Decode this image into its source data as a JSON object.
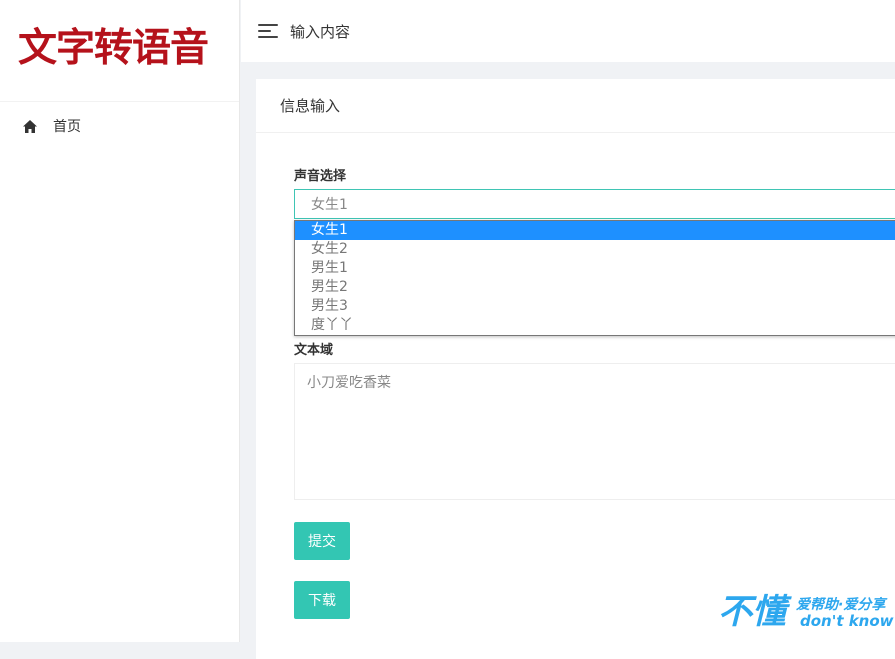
{
  "app": {
    "logo_text": "文字转语音"
  },
  "sidebar": {
    "items": [
      {
        "label": "首页",
        "icon": "home-icon"
      }
    ]
  },
  "header": {
    "title": "输入内容"
  },
  "card": {
    "title": "信息输入",
    "voice_label": "声音选择",
    "voice_selected": "女生1",
    "voice_options": [
      "女生1",
      "女生2",
      "男生1",
      "男生2",
      "男生3",
      "度丫丫"
    ],
    "textarea_label": "文本域",
    "textarea_value": "小刀爱吃香菜",
    "submit_label": "提交",
    "download_label": "下载"
  },
  "watermark": {
    "big": "不懂",
    "line1": "爱帮助·爱分享",
    "line2": "don't know"
  },
  "colors": {
    "accent": "#33c6b3",
    "logo": "#b5121b",
    "highlight": "#1e90ff"
  }
}
